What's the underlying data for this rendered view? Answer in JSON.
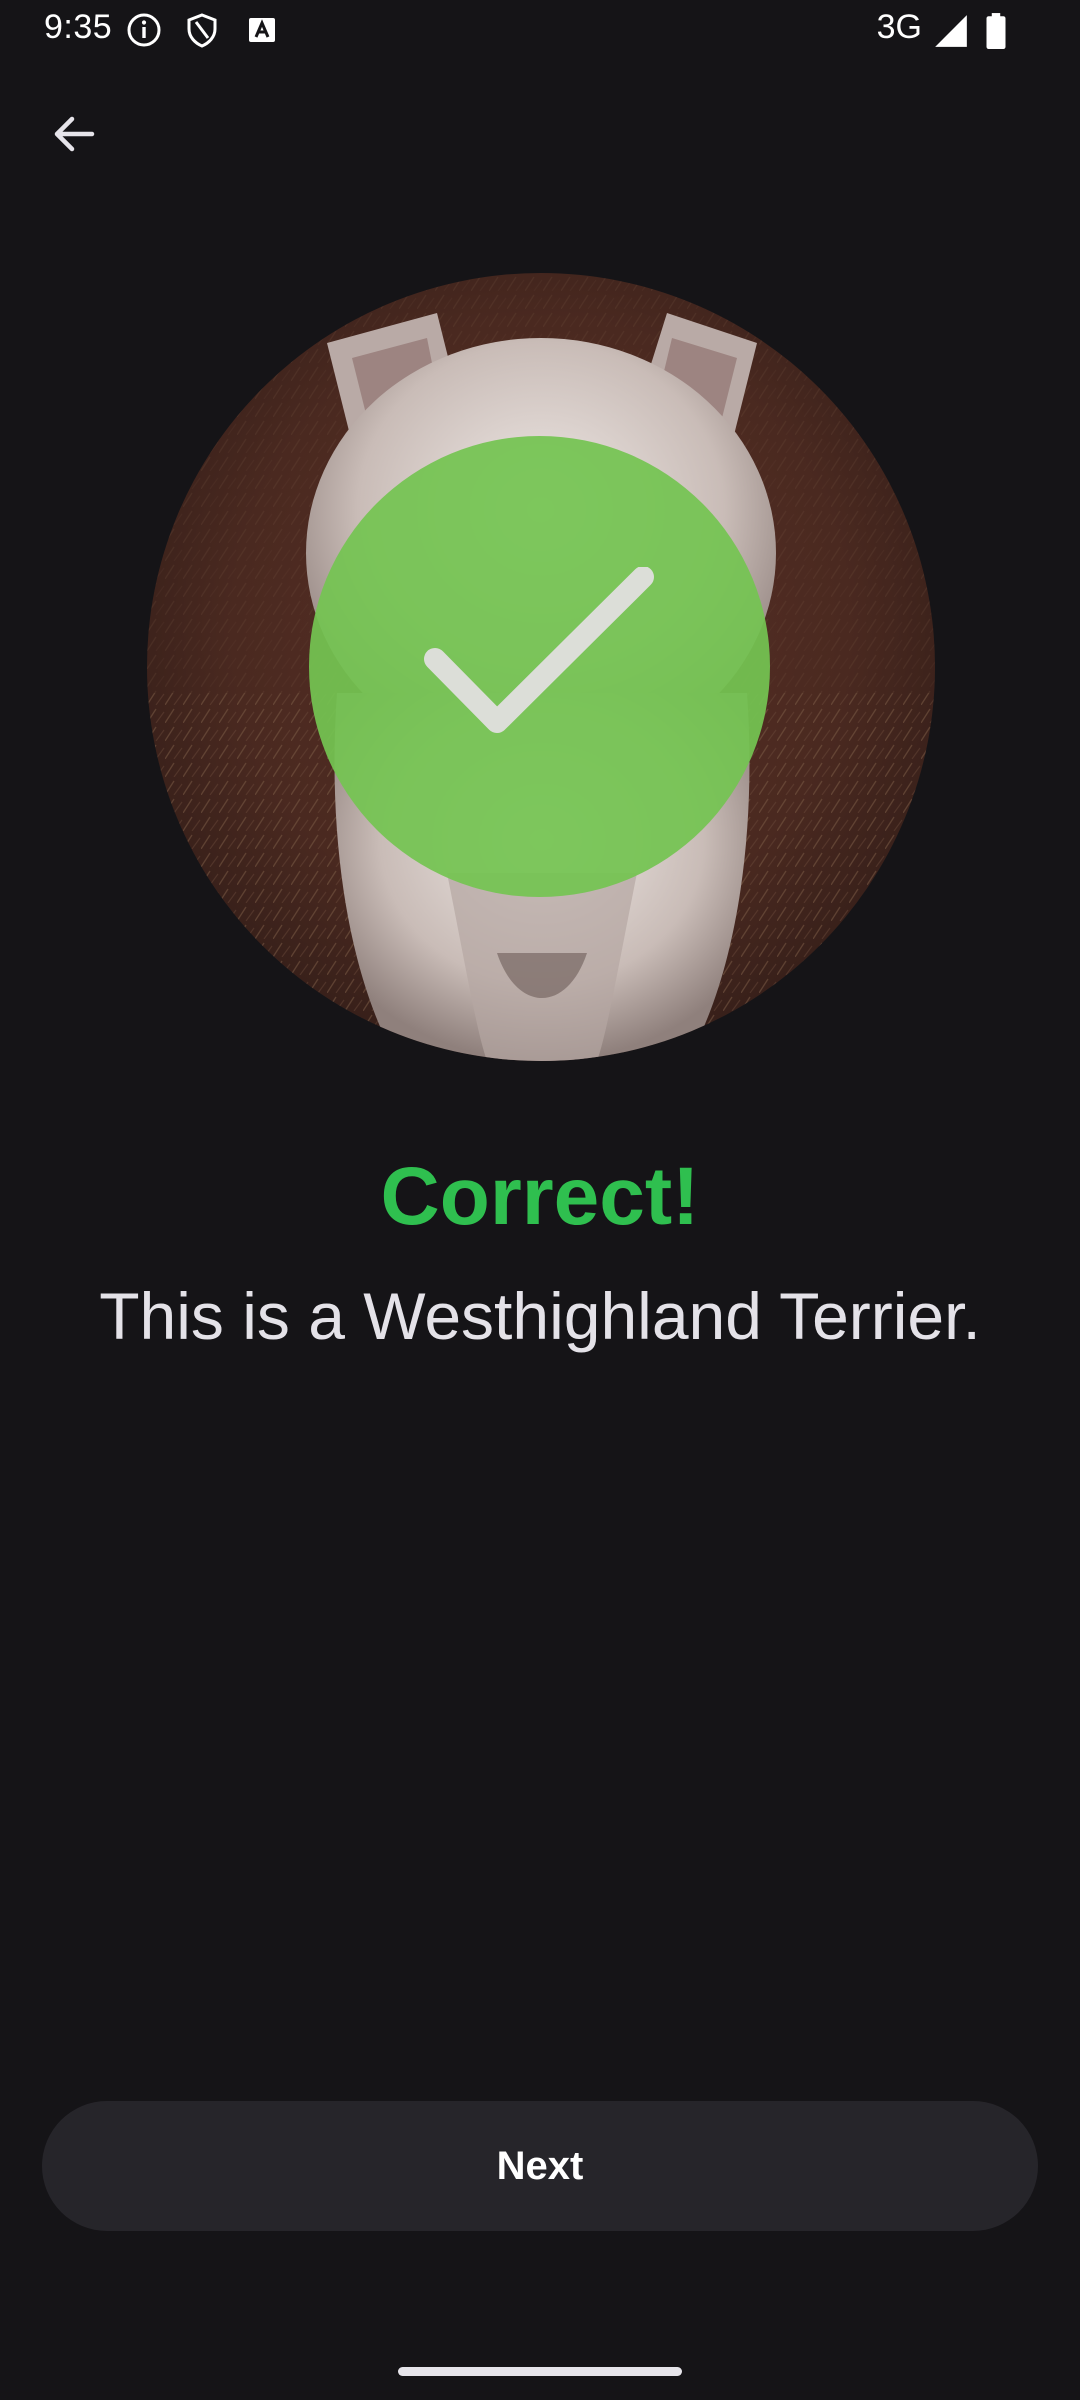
{
  "status_bar": {
    "time": "9:35",
    "network": "3G",
    "icons": [
      "info-icon",
      "shield-icon",
      "keyboard-a-icon",
      "signal-icon",
      "battery-icon"
    ]
  },
  "header": {
    "back_icon": "arrow-left-icon"
  },
  "quiz": {
    "result_icon": "checkmark-icon",
    "result_title": "Correct!",
    "result_message": "This is a Westhighland Terrier."
  },
  "actions": {
    "next_label": "Next"
  },
  "colors": {
    "background": "#151417",
    "correct_accent": "#2fbf4f",
    "badge_green": "#74c452",
    "button_bg": "#26252a"
  }
}
